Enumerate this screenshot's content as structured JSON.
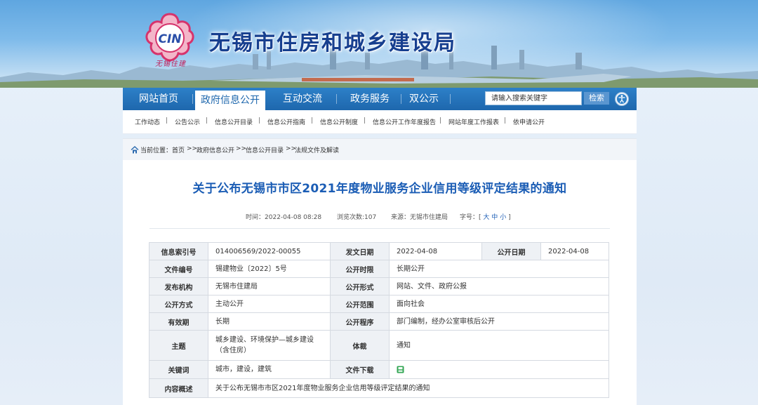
{
  "header": {
    "logo_text": "CIN",
    "logo_sub": "无锡住建",
    "site_title": "无锡市住房和城乡建设局"
  },
  "nav": {
    "items": [
      {
        "label": "网站首页"
      },
      {
        "label": "政府信息公开",
        "active": true
      },
      {
        "label": "互动交流"
      },
      {
        "label": "政务服务"
      },
      {
        "label": "双公示"
      }
    ],
    "search_placeholder": "请输入搜索关键字",
    "search_button": "检索"
  },
  "subnav": {
    "items": [
      "工作动态",
      "公告公示",
      "信息公开目录",
      "信息公开指南",
      "信息公开制度",
      "信息公开工作年度报告",
      "网站年度工作报表",
      "依申请公开"
    ]
  },
  "breadcrumb": {
    "prefix": "当前位置：",
    "items": [
      "首页",
      "政府信息公开",
      "信息公开目录",
      "法规文件及解读"
    ],
    "separator": ">>"
  },
  "article": {
    "title": "关于公布无锡市市区2021年度物业服务企业信用等级评定结果的通知",
    "time_label": "时间：",
    "time": "2022-04-08 08:28",
    "views_label": "浏览次数:",
    "views": "107",
    "source_label": "来源：",
    "source": "无锡市住建局",
    "fontsize_label": "字号：",
    "fontsize_open": "[",
    "fontsize_close": "]",
    "fontsize_large": "大",
    "fontsize_medium": "中",
    "fontsize_small": "小"
  },
  "info": {
    "index_no_label": "信息索引号",
    "index_no": "014006569/2022-00055",
    "issue_date_label": "发文日期",
    "issue_date": "2022-04-08",
    "publish_date_label": "公开日期",
    "publish_date": "2022-04-08",
    "doc_no_label": "文件编号",
    "doc_no": "锡建物业〔2022〕5号",
    "period_label": "公开时限",
    "period": "长期公开",
    "agency_label": "发布机构",
    "agency": "无锡市住建局",
    "form_label": "公开形式",
    "form": "网站、文件、政府公报",
    "method_label": "公开方式",
    "method": "主动公开",
    "scope_label": "公开范围",
    "scope": "面向社会",
    "validity_label": "有效期",
    "validity": "长期",
    "procedure_label": "公开程序",
    "procedure": "部门编制，经办公室审核后公开",
    "topic_label": "主题",
    "topic_line1": "城乡建设、环境保护—城乡建设",
    "topic_line2": "（含住房）",
    "genre_label": "体裁",
    "genre": "通知",
    "keywords_label": "关键词",
    "keywords": "城市，建设，建筑",
    "download_label": "文件下载",
    "download_icon": "file-download-icon",
    "summary_label": "内容概述",
    "summary": "关于公布无锡市市区2021年度物业服务企业信用等级评定结果的通知"
  },
  "colors": {
    "nav_blue": "#1e67ad",
    "title_blue": "#1b5db5",
    "site_title": "#173f8f",
    "logo_pink": "#d6336c"
  }
}
